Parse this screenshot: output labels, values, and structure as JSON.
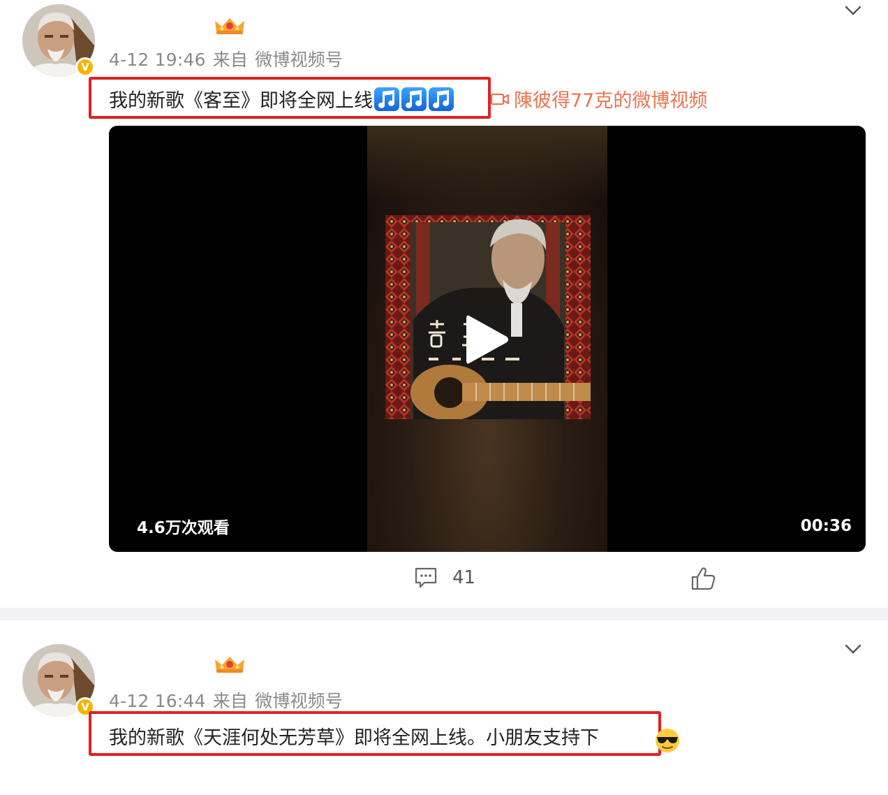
{
  "posts": [
    {
      "verified_badge": "V",
      "timestamp": "4-12 19:46",
      "source_prefix": "来自",
      "source": "微博视频号",
      "content": "我的新歌《客至》即将全网上线",
      "video_link_label": "陳彼得77克的微博视频",
      "video": {
        "views": "4.6万次观看",
        "duration": "00:36"
      },
      "comment_count": "41"
    },
    {
      "verified_badge": "V",
      "timestamp": "4-12 16:44",
      "source_prefix": "来自",
      "source": "微博视频号",
      "content": "我的新歌《天涯何处无芳草》即将全网上线。小朋友支持下"
    }
  ],
  "icons": {
    "crown": "crown-icon",
    "expand": "chevron-down-icon",
    "music_note": "music-note-icon",
    "video_camera": "video-camera-icon",
    "play": "play-icon",
    "comment": "comment-icon",
    "like": "thumbs-up-icon",
    "emoji": "cool-sunglasses-emoji-icon"
  },
  "colors": {
    "highlight_border": "#e02020",
    "video_link": "#eb7350",
    "meta_text": "#8a8a8a",
    "separator": "#f1f2f5",
    "verified": "#f6b400"
  }
}
